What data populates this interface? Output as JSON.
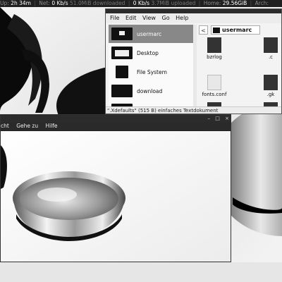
{
  "statusbar": {
    "uptime_label": "Up:",
    "uptime_value": "2h 34m",
    "net_label": "Net:",
    "down_rate": "0 Kb/s",
    "down_total": "51.0MiB downloaded",
    "up_rate": "0 Kb/s",
    "up_total": "3.7MiB uploaded",
    "home_label": "Home:",
    "home_value": "29.56GiB",
    "arch_label": "Arch:"
  },
  "file_manager": {
    "menu": [
      "File",
      "Edit",
      "View",
      "Go",
      "Help"
    ],
    "places": [
      {
        "label": "usermarc",
        "icon": "home-folder-icon",
        "selected": true
      },
      {
        "label": "Desktop",
        "icon": "desktop-icon",
        "selected": false
      },
      {
        "label": "File System",
        "icon": "drive-icon",
        "selected": false
      },
      {
        "label": "download",
        "icon": "folder-icon",
        "selected": false
      },
      {
        "label": "",
        "icon": "folder-icon",
        "selected": false
      }
    ],
    "back_glyph": "<",
    "current_folder": "usermarc",
    "files": [
      {
        "name": "bzrlog",
        "icon": "file-icon"
      },
      {
        "name": ".c",
        "icon": "file-icon"
      },
      {
        "name": "fonts.conf",
        "icon": "text-file-icon"
      },
      {
        "name": ".gk",
        "icon": "file-icon"
      },
      {
        "name": "",
        "icon": "file-icon"
      },
      {
        "name": "",
        "icon": "file-icon"
      }
    ],
    "status": "\".Xdefaults\" (515 B) einfaches Textdokument"
  },
  "viewer": {
    "menu": [
      "cht",
      "Gehe zu",
      "Hilfe"
    ],
    "window_buttons": [
      "–",
      "□",
      "×"
    ]
  }
}
